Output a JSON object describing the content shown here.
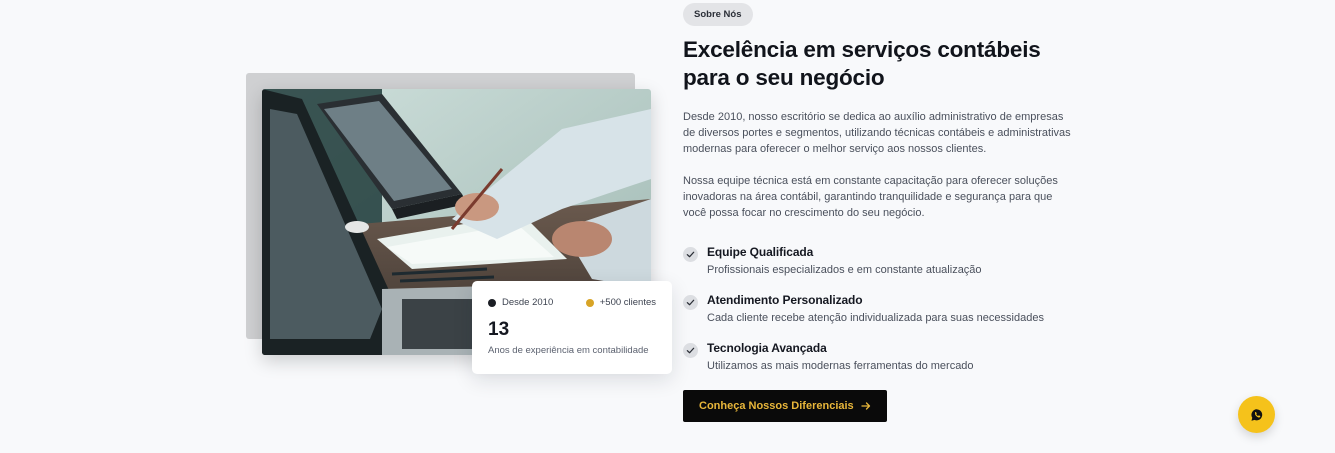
{
  "about": {
    "badge": "Sobre Nós",
    "title_line1": "Excelência em serviços contábeis",
    "title_line2": "para o seu negócio",
    "paragraph1": "Desde 2010, nosso escritório se dedica ao auxílio administrativo de empresas de diversos portes e segmentos, utilizando técnicas contábeis e administrativas modernas para oferecer o melhor serviço aos nossos clientes.",
    "paragraph2": "Nossa equipe técnica está em constante capacitação para oferecer soluções inovadoras na área contábil, garantindo tranquilidade e segurança para que você possa focar no crescimento do seu negócio.",
    "features": [
      {
        "title": "Equipe Qualificada",
        "description": "Profissionais especializados e em constante atualização"
      },
      {
        "title": "Atendimento Personalizado",
        "description": "Cada cliente recebe atenção individualizada para suas necessidades"
      },
      {
        "title": "Tecnologia Avançada",
        "description": "Utilizamos as mais modernas ferramentas do mercado"
      }
    ],
    "cta_label": "Conheça Nossos Diferenciais"
  },
  "stat_card": {
    "tag_since": "Desde 2010",
    "tag_clients": "+500 clientes",
    "number": "13",
    "caption": "Anos de experiência em contabilidade"
  },
  "icons": {
    "check": "check-icon",
    "arrow": "arrow-right-icon",
    "chat": "whatsapp-icon"
  },
  "colors": {
    "accent_gold": "#d8a426",
    "cta_background": "#0a0a0a",
    "whatsapp_button": "#f5c21b"
  }
}
